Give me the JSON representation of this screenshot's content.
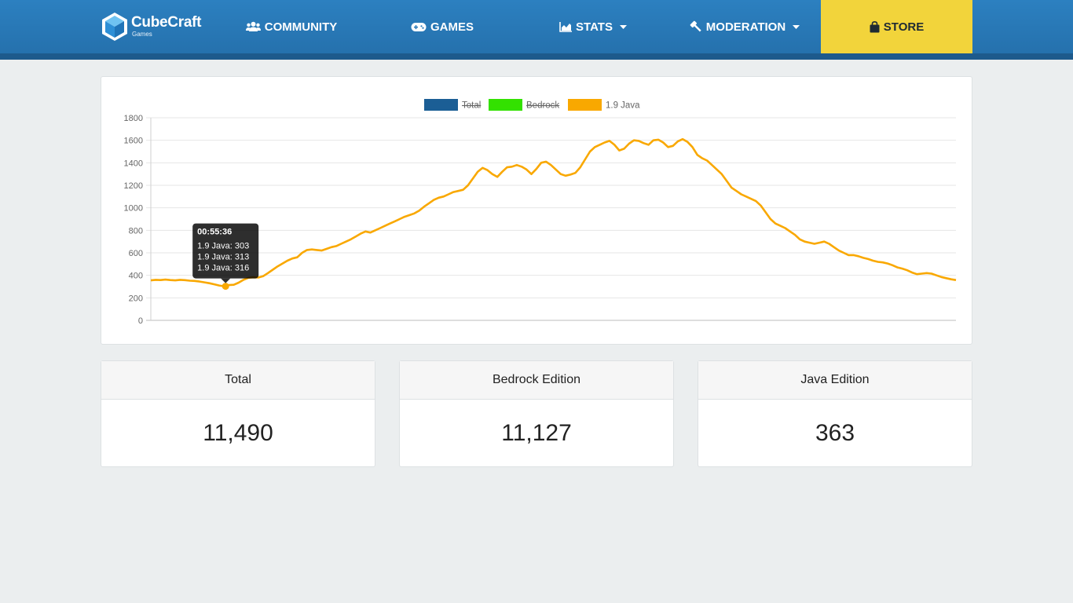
{
  "brand": {
    "name": "CubeCraft",
    "sub": "Games"
  },
  "nav": {
    "community": "COMMUNITY",
    "games": "GAMES",
    "stats": "STATS",
    "moderation": "MODERATION",
    "store": "STORE"
  },
  "colors": {
    "nav_bg": "#2a7ab9",
    "store": "#f2d43b",
    "total": "#1b5e95",
    "bedrock": "#33e100",
    "java": "#f9a800"
  },
  "icons": {
    "community": "users-icon",
    "games": "gamepad-icon",
    "stats": "area-chart-icon",
    "moderation": "gavel-icon",
    "store": "shopping-bag-icon"
  },
  "chart_data": {
    "type": "line",
    "series": [
      {
        "name": "Total",
        "hidden": true,
        "color": "#1b5e95"
      },
      {
        "name": "Bedrock",
        "hidden": true,
        "color": "#33e100"
      },
      {
        "name": "1.9 Java",
        "hidden": false,
        "color": "#f9a800",
        "values": [
          355,
          360,
          358,
          362,
          358,
          355,
          360,
          357,
          352,
          350,
          345,
          338,
          330,
          320,
          310,
          303,
          313,
          316,
          335,
          360,
          378,
          382,
          380,
          392,
          420,
          450,
          480,
          505,
          530,
          550,
          560,
          600,
          625,
          630,
          625,
          620,
          635,
          650,
          660,
          680,
          700,
          720,
          745,
          770,
          790,
          780,
          800,
          820,
          840,
          860,
          880,
          900,
          920,
          935,
          950,
          975,
          1010,
          1040,
          1070,
          1090,
          1100,
          1120,
          1140,
          1150,
          1160,
          1200,
          1260,
          1320,
          1355,
          1335,
          1300,
          1275,
          1320,
          1360,
          1365,
          1380,
          1365,
          1340,
          1300,
          1345,
          1400,
          1410,
          1380,
          1340,
          1300,
          1285,
          1295,
          1310,
          1360,
          1430,
          1500,
          1540,
          1560,
          1580,
          1595,
          1560,
          1510,
          1525,
          1570,
          1600,
          1595,
          1575,
          1560,
          1600,
          1605,
          1580,
          1540,
          1550,
          1590,
          1610,
          1585,
          1540,
          1470,
          1440,
          1420,
          1380,
          1340,
          1300,
          1240,
          1180,
          1150,
          1120,
          1100,
          1080,
          1060,
          1020,
          960,
          900,
          860,
          840,
          820,
          790,
          760,
          720,
          700,
          690,
          680,
          690,
          700,
          680,
          650,
          620,
          600,
          580,
          580,
          570,
          555,
          545,
          530,
          520,
          515,
          505,
          490,
          470,
          460,
          445,
          425,
          410,
          415,
          420,
          415,
          400,
          385,
          375,
          365,
          358
        ]
      }
    ],
    "ylim": [
      0,
      1800
    ],
    "yticks": [
      "0",
      "200",
      "400",
      "600",
      "800",
      "1000",
      "1200",
      "1400",
      "1600",
      "1800"
    ],
    "grid": true,
    "legend": "top-center",
    "tooltip": {
      "title": "00:55:36",
      "lines": [
        "1.9 Java: 303",
        "1.9 Java: 313",
        "1.9 Java: 316"
      ],
      "anchor_index": 15
    }
  },
  "stats": {
    "total": {
      "label": "Total",
      "value": "11,490"
    },
    "bedrock": {
      "label": "Bedrock Edition",
      "value": "11,127"
    },
    "java": {
      "label": "Java Edition",
      "value": "363"
    }
  }
}
